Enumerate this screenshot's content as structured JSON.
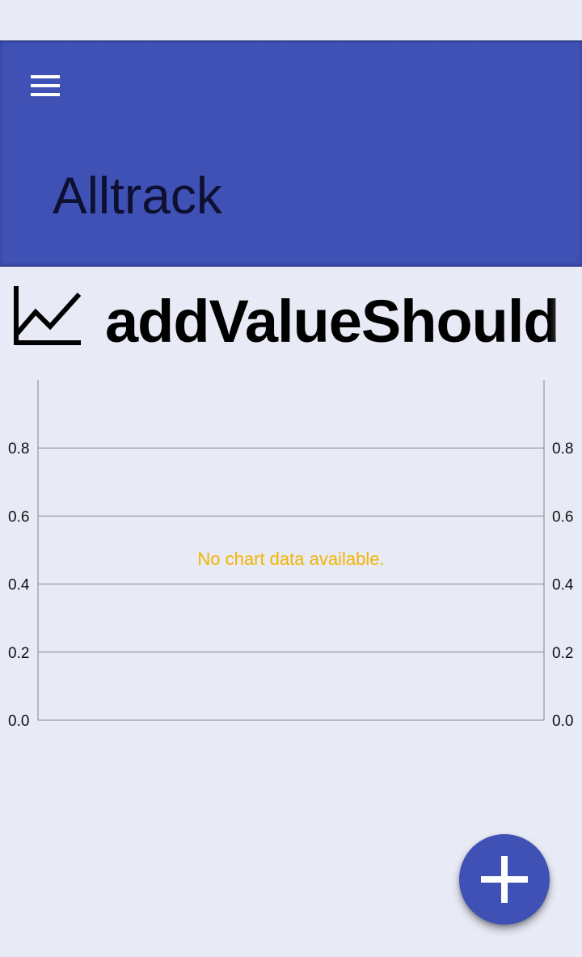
{
  "app_bar": {
    "title": "Alltrack",
    "background": "#3f51b5",
    "menu_icon": "hamburger-menu-icon"
  },
  "metric": {
    "icon": "line-chart-icon",
    "title": "addValueShould"
  },
  "chart_data": {
    "type": "line",
    "title": "",
    "xlabel": "",
    "ylabel": "",
    "series": [],
    "ylim": [
      0,
      1.0
    ],
    "y_ticks_left": [
      "0.0",
      "0.2",
      "0.4",
      "0.6",
      "0.8"
    ],
    "y_ticks_right": [
      "0.0",
      "0.2",
      "0.4",
      "0.6",
      "0.8"
    ],
    "grid": true,
    "no_data_text": "No chart data available.",
    "no_data_color": "#f4b400"
  },
  "fab": {
    "icon": "plus-icon",
    "background": "#3f51b5"
  }
}
